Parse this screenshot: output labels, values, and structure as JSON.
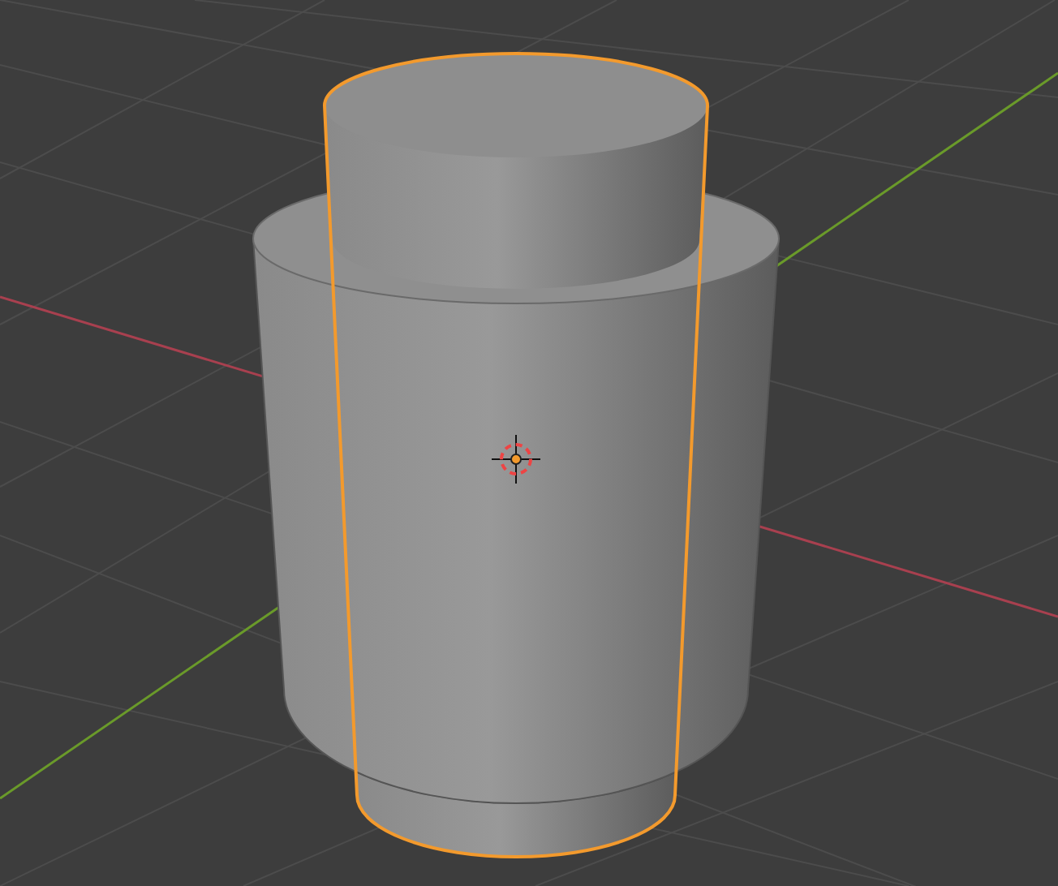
{
  "viewport": {
    "objects": [
      {
        "kind": "cylinder",
        "selected": false
      },
      {
        "kind": "cylinder",
        "selected": true
      }
    ]
  }
}
